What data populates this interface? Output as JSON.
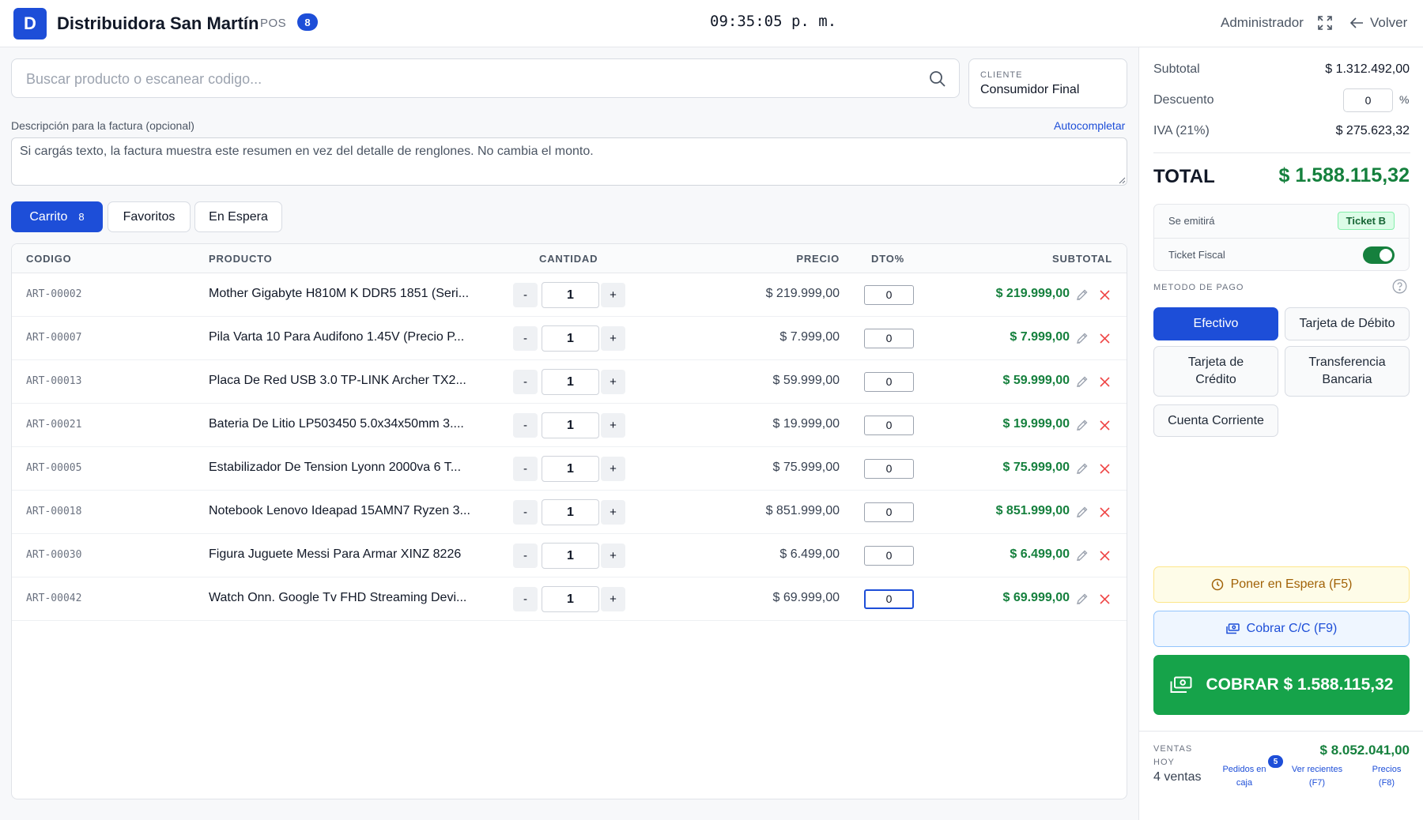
{
  "header": {
    "logo_letter": "D",
    "title": "Distribuidora San Martín",
    "subtitle": "POS",
    "badge": "8",
    "clock": "09:35:05 p. m.",
    "user": "Administrador",
    "back_label": "Volver"
  },
  "search": {
    "placeholder": "Buscar producto o escanear codigo...",
    "value": ""
  },
  "cliente": {
    "label": "CLIENTE",
    "value": "Consumidor Final"
  },
  "description": {
    "label": "Descripción para la factura (opcional)",
    "autocomplete_label": "Autocompletar",
    "value": "Si cargás texto, la factura muestra este resumen en vez del detalle de renglones. No cambia el monto."
  },
  "tabs": [
    {
      "label": "Carrito",
      "count": "8",
      "active": true
    },
    {
      "label": "Favoritos"
    },
    {
      "label": "En Espera"
    }
  ],
  "table": {
    "headers": {
      "code": "CODIGO",
      "product": "PRODUCTO",
      "qty": "CANTIDAD",
      "price": "PRECIO",
      "discount": "DTO%",
      "subtotal": "SUBTOTAL"
    },
    "rows": [
      {
        "code": "ART-00002",
        "product": "Mother Gigabyte H810M K DDR5 1851 (Seri...",
        "qty": "1",
        "price": "$ 219.999,00",
        "discount": "0",
        "subtotal": "$ 219.999,00"
      },
      {
        "code": "ART-00007",
        "product": "Pila Varta 10 Para Audifono 1.45V (Precio P...",
        "qty": "1",
        "price": "$ 7.999,00",
        "discount": "0",
        "subtotal": "$ 7.999,00"
      },
      {
        "code": "ART-00013",
        "product": "Placa De Red USB 3.0 TP-LINK Archer TX2...",
        "qty": "1",
        "price": "$ 59.999,00",
        "discount": "0",
        "subtotal": "$ 59.999,00"
      },
      {
        "code": "ART-00021",
        "product": "Bateria De Litio LP503450 5.0x34x50mm 3....",
        "qty": "1",
        "price": "$ 19.999,00",
        "discount": "0",
        "subtotal": "$ 19.999,00"
      },
      {
        "code": "ART-00005",
        "product": "Estabilizador De Tension Lyonn 2000va 6 T...",
        "qty": "1",
        "price": "$ 75.999,00",
        "discount": "0",
        "subtotal": "$ 75.999,00"
      },
      {
        "code": "ART-00018",
        "product": "Notebook Lenovo Ideapad 15AMN7 Ryzen 3...",
        "qty": "1",
        "price": "$ 851.999,00",
        "discount": "0",
        "subtotal": "$ 851.999,00"
      },
      {
        "code": "ART-00030",
        "product": "Figura Juguete Messi Para Armar XINZ 8226",
        "qty": "1",
        "price": "$ 6.499,00",
        "discount": "0",
        "subtotal": "$ 6.499,00"
      },
      {
        "code": "ART-00042",
        "product": "Watch Onn. Google Tv FHD Streaming Devi...",
        "qty": "1",
        "price": "$ 69.999,00",
        "discount": "0",
        "subtotal": "$ 69.999,00"
      }
    ],
    "minus_label": "-",
    "plus_label": "+"
  },
  "summary": {
    "subtotal_label": "Subtotal",
    "subtotal_value": "$ 1.312.492,00",
    "discount_label": "Descuento",
    "discount_value": "0",
    "discount_unit": "%",
    "iva_label": "IVA (21%)",
    "iva_value": "$ 275.623,32",
    "total_label": "TOTAL",
    "total_value": "$ 1.588.115,32"
  },
  "fiscal": {
    "emit_label": "Se emitirá",
    "emit_value": "Ticket B",
    "ticket_label": "Ticket Fiscal",
    "ticket_enabled": true
  },
  "payment": {
    "label": "METODO DE PAGO",
    "methods": [
      "Efectivo",
      "Tarjeta de Débito",
      "Tarjeta de Crédito",
      "Transferencia Bancaria",
      "Cuenta Corriente"
    ],
    "selected": "Efectivo"
  },
  "actions": {
    "hold_label": "Poner en Espera (F5)",
    "cc_label": "Cobrar C/C (F9)",
    "charge_label": "COBRAR $ 1.588.115,32"
  },
  "footer": {
    "sales_label": "VENTAS HOY",
    "sales_count": "4 ventas",
    "sales_total": "$ 8.052.041,00",
    "orders_label": "Pedidos en caja",
    "orders_badge": "5",
    "recent_label": "Ver recientes (F7)",
    "prices_label": "Precios (F8)"
  },
  "colors": {
    "primary": "#1d4ed8",
    "success": "#16a34a",
    "money": "#15803d",
    "warning_bg": "#fefce8"
  }
}
